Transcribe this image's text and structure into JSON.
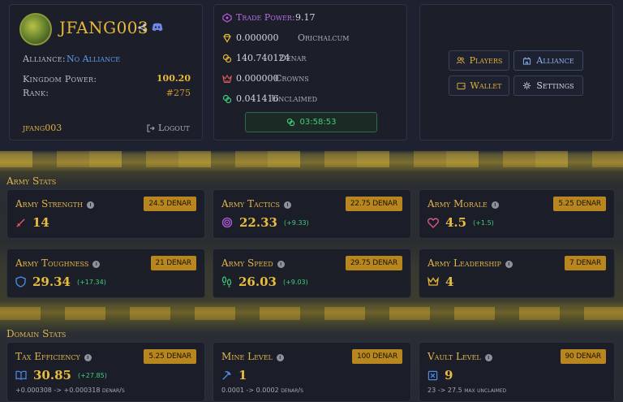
{
  "profile": {
    "username": "JFANG003",
    "alliance_label": "Alliance:",
    "alliance_value": "No Alliance",
    "kingdom_power_label": "Kingdom Power:",
    "kingdom_power_value": "100.20",
    "rank_label": "Rank:",
    "rank_value": "#275",
    "footer_name": "jfang003",
    "logout_label": "Logout"
  },
  "resources": {
    "trade_power_label": "Trade Power:",
    "trade_power_value": "9.17",
    "orichalcum_value": "0.000000",
    "orichalcum_label": "Orichalcum",
    "denar_value": "140.740124",
    "denar_label": "Denar",
    "crowns_value": "0.000000",
    "crowns_label": "Crowns",
    "unclaimed_value": "0.041416",
    "unclaimed_label": "Unclaimed",
    "timer": "03:58:53"
  },
  "nav": {
    "players": "Players",
    "alliance": "Alliance",
    "wallet": "Wallet",
    "settings": "Settings"
  },
  "sections": {
    "army": "Army Stats",
    "domain": "Domain Stats"
  },
  "army_stats": [
    {
      "title": "Army Strength",
      "cost": "24.5 DENAR",
      "value": "14",
      "bonus": "",
      "icon": "sword-icon",
      "color": "#e0545a"
    },
    {
      "title": "Army Tactics",
      "cost": "22.75 DENAR",
      "value": "22.33",
      "bonus": "(+9.33)",
      "icon": "target-icon",
      "color": "#b65be0"
    },
    {
      "title": "Army Morale",
      "cost": "5.25 DENAR",
      "value": "4.5",
      "bonus": "(+1.5)",
      "icon": "heart-icon",
      "color": "#e25b8a"
    },
    {
      "title": "Army Toughness",
      "cost": "21 DENAR",
      "value": "29.34",
      "bonus": "(+17.34)",
      "icon": "shield-icon",
      "color": "#4d8de8"
    },
    {
      "title": "Army Speed",
      "cost": "29.75 DENAR",
      "value": "26.03",
      "bonus": "(+9.03)",
      "icon": "footprints-icon",
      "color": "#3ecf7a"
    },
    {
      "title": "Army Leadership",
      "cost": "7 DENAR",
      "value": "4",
      "bonus": "",
      "icon": "crown-icon",
      "color": "#e8b838"
    }
  ],
  "domain_stats": [
    {
      "title": "Tax Efficiency",
      "cost": "5.25 DENAR",
      "value": "30.85",
      "bonus": "(+27.85)",
      "sub": "+0.000308 -> +0.000318 denar/s",
      "icon": "book-icon",
      "color": "#4d8de8"
    },
    {
      "title": "Mine Level",
      "cost": "100 DENAR",
      "value": "1",
      "bonus": "",
      "sub": "0.0001 -> 0.0002 denar/s",
      "icon": "pickaxe-icon",
      "color": "#4d8de8"
    },
    {
      "title": "Vault Level",
      "cost": "90 DENAR",
      "value": "9",
      "bonus": "",
      "sub": "23 -> 27.5 max unclaimed",
      "icon": "vault-icon",
      "color": "#4d8de8"
    }
  ],
  "colors": {
    "gold": "#e8b838",
    "accent_blue": "#4d8de8",
    "bonus_green": "#3ecf7a",
    "badge": "#b8861e"
  }
}
